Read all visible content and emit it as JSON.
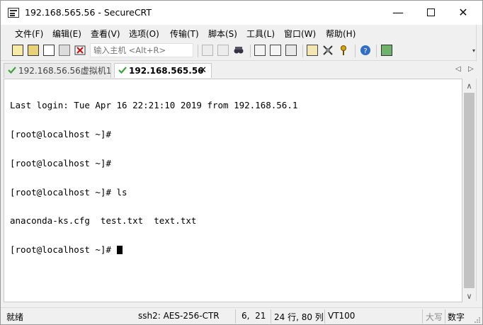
{
  "window": {
    "title": "192.168.565.56 - SecureCRT"
  },
  "menu": [
    "文件(F)",
    "编辑(E)",
    "查看(V)",
    "选项(O)",
    "传输(T)",
    "脚本(S)",
    "工具(L)",
    "窗口(W)",
    "帮助(H)"
  ],
  "toolbar": {
    "host_placeholder": "输入主机 <Alt+R>"
  },
  "tabs": [
    {
      "label": "192.168.56.56虚拟机1",
      "active": false
    },
    {
      "label": "192.168.565.56",
      "active": true
    }
  ],
  "terminal": {
    "lines": [
      "Last login: Tue Apr 16 22:21:10 2019 from 192.168.56.1",
      "[root@localhost ~]#",
      "[root@localhost ~]#",
      "[root@localhost ~]# ls",
      "anaconda-ks.cfg  test.txt  text.txt",
      "[root@localhost ~]# "
    ]
  },
  "status": {
    "ready": "就绪",
    "cipher": "ssh2: AES-256-CTR",
    "cursor_pos": "6,  21",
    "size": "24 行, 80 列",
    "emulation": "VT100",
    "caps": "大写",
    "num": "数字"
  },
  "colors": {
    "accent_check": "#3aa537",
    "terminal_bg": "#ffffff"
  }
}
